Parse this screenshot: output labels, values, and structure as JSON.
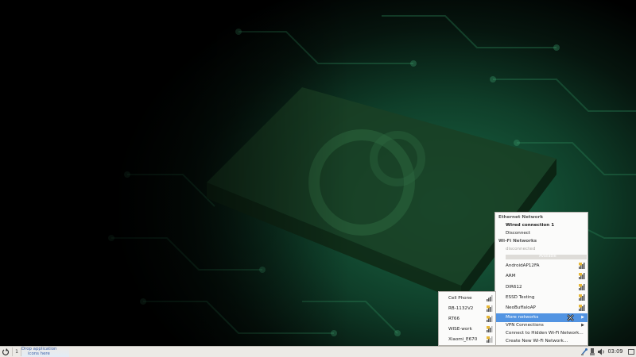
{
  "taskbar": {
    "desktop_number": "1",
    "drop_hint_line1": "Drop application",
    "drop_hint_line2": "icons here",
    "clock": "03:09",
    "icons": [
      "menu-icon",
      "network-icon",
      "usb-device-icon",
      "volume-icon",
      "show-desktop-icon"
    ]
  },
  "network_menu": {
    "ethernet_header": "Ethernet Network",
    "wired_connection": "Wired connection 1",
    "disconnect": "Disconnect",
    "wifi_header": "Wi-Fi Networks",
    "wifi_status": "disconnected",
    "available_label": "Available",
    "networks": [
      {
        "ssid": "AndroidAP12FA"
      },
      {
        "ssid": "ARM"
      },
      {
        "ssid": "DIR612"
      },
      {
        "ssid": "ESSD Testing"
      },
      {
        "ssid": "NeoBuffaloAP"
      }
    ],
    "more_networks": "More networks",
    "vpn_connections": "VPN Connections",
    "connect_hidden": "Connect to Hidden Wi-Fi Network...",
    "create_new": "Create New Wi-Fi Network..."
  },
  "more_networks_submenu": {
    "networks": [
      {
        "ssid": "Cell Phone"
      },
      {
        "ssid": "RB-1132V2"
      },
      {
        "ssid": "RT66"
      },
      {
        "ssid": "WISE-work"
      },
      {
        "ssid": "Xiaomi_E670"
      }
    ]
  },
  "colors": {
    "selection": "#5294e2",
    "menu_bg": "#fbfbfa",
    "taskbar_bg": "#eceae6",
    "wallpaper_green": "#1b6a47"
  }
}
